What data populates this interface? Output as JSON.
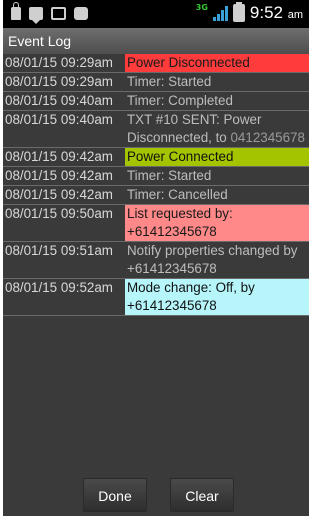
{
  "status_bar": {
    "icons": [
      "lock-icon",
      "chat-icon",
      "image-icon",
      "bag-icon"
    ],
    "network": "3G",
    "time": "9:52",
    "ampm": "am"
  },
  "title": "Event Log",
  "entries": [
    {
      "time": "08/01/15 09:29am",
      "message": "Power Disconnected",
      "extra": "",
      "highlight": "red"
    },
    {
      "time": "08/01/15 09:29am",
      "message": "Timer: Started",
      "extra": "",
      "highlight": ""
    },
    {
      "time": "08/01/15 09:40am",
      "message": "Timer: Completed",
      "extra": "",
      "highlight": ""
    },
    {
      "time": "08/01/15 09:40am",
      "message": "TXT #10 SENT: Power Disconnected, to",
      "extra": "0412345678",
      "highlight": ""
    },
    {
      "time": "08/01/15 09:42am",
      "message": "Power Connected",
      "extra": "",
      "highlight": "green"
    },
    {
      "time": "08/01/15 09:42am",
      "message": "Timer: Started",
      "extra": "",
      "highlight": ""
    },
    {
      "time": "08/01/15 09:42am",
      "message": "Timer: Cancelled",
      "extra": "",
      "highlight": ""
    },
    {
      "time": "08/01/15 09:50am",
      "message": "List requested by: +61412345678",
      "extra": "",
      "highlight": "pink"
    },
    {
      "time": "08/01/15 09:51am",
      "message": "Notify properties changed by +61412345678",
      "extra": "",
      "highlight": ""
    },
    {
      "time": "08/01/15 09:52am",
      "message": "Mode change: Off, by +61412345678",
      "extra": "",
      "highlight": "cyan"
    }
  ],
  "buttons": {
    "done": "Done",
    "clear": "Clear"
  },
  "colors": {
    "red": "#ff3b3b",
    "green": "#a4c400",
    "pink": "#ff8888",
    "cyan": "#b6f6fb"
  }
}
